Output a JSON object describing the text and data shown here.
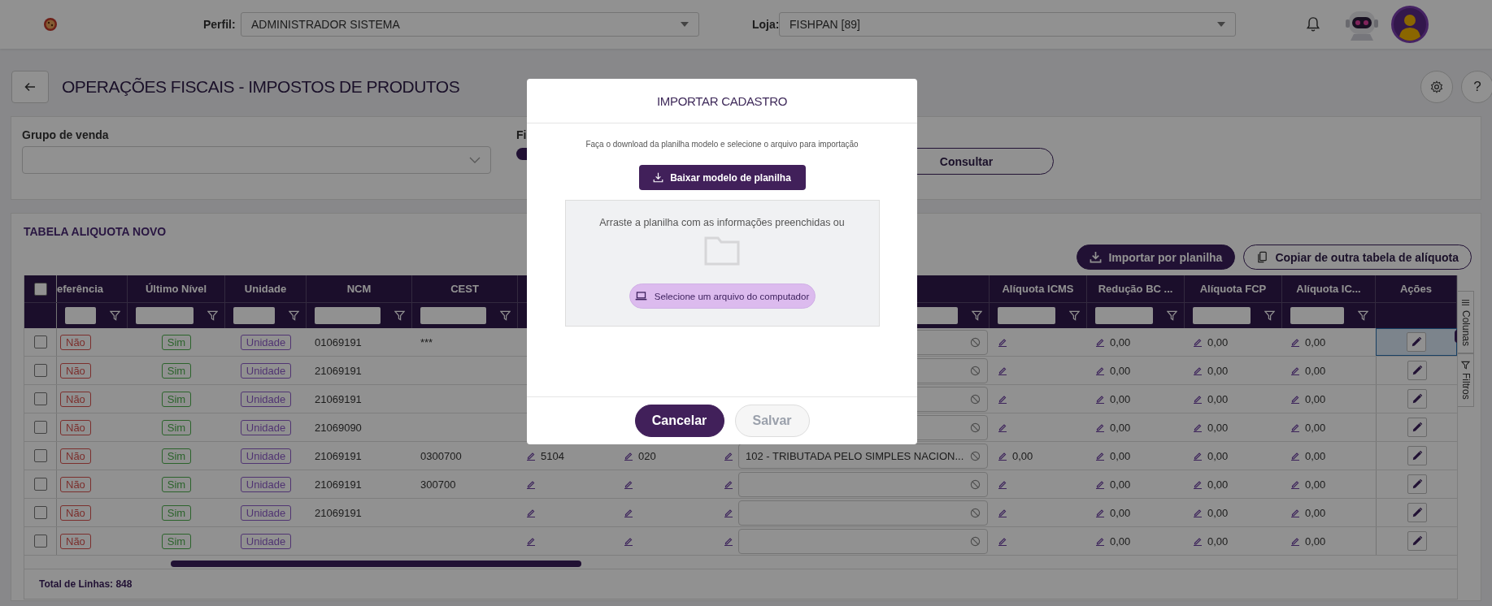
{
  "header": {
    "perfil": {
      "label": "Perfil:",
      "value": "ADMINISTRADOR SISTEMA"
    },
    "loja": {
      "label": "Loja:",
      "value": "FISHPAN [89]"
    }
  },
  "page_title": "OPERAÇÕES FISCAIS - IMPOSTOS DE PRODUTOS",
  "help_button": "?",
  "filters": {
    "grupo_de_venda": {
      "label": "Grupo de venda"
    },
    "column_2": {
      "label": "Fi",
      "on": true
    },
    "button": "Consultar"
  },
  "table": {
    "title": "TABELA ALIQUOTA NOVO",
    "buttons": [
      {
        "label": "Importar por planilha",
        "kind": "primary"
      },
      {
        "label": "Copiar de outra tabela de alíquota",
        "kind": "outline"
      }
    ],
    "select_all": false,
    "columns": [
      {
        "kind": "danger",
        "label": "eferência",
        "filter": true
      },
      {
        "kind": "success",
        "label": "Último Nível",
        "filter": true
      },
      {
        "kind": "info",
        "label": "Unidade",
        "filter": true
      },
      {
        "kind": "text",
        "label": "NCM",
        "filter": true
      },
      {
        "kind": "text",
        "label": "CEST",
        "filter": true
      },
      {
        "kind": "edit"
      },
      {
        "kind": "edit"
      },
      {
        "kind": "field",
        "filter": true
      },
      {
        "kind": "edit",
        "label": "Alíquota ICMS",
        "filter": true
      },
      {
        "kind": "edit",
        "label": "Redução BC ...",
        "filter": true
      },
      {
        "kind": "edit",
        "label": "Alíquota FCP",
        "filter": true
      },
      {
        "kind": "edit",
        "label": "Alíquota IC...",
        "filter": true
      },
      {
        "kind": "action",
        "label": "Ações",
        "filter": false
      }
    ],
    "rows": [
      {
        "checked": false,
        "selected": true,
        "cells": [
          "Não",
          "Sim",
          "Unidade",
          "01069191",
          "***",
          null,
          null,
          true,
          true,
          "0,00",
          "0,00",
          "0,00",
          true
        ]
      },
      {
        "checked": false,
        "selected": false,
        "cells": [
          "Não",
          "Sim",
          "Unidade",
          "21069191",
          null,
          null,
          null,
          true,
          true,
          "0,00",
          "0,00",
          "0,00",
          true
        ]
      },
      {
        "checked": false,
        "selected": false,
        "cells": [
          "Não",
          "Sim",
          "Unidade",
          "21069191",
          null,
          null,
          null,
          true,
          true,
          "0,00",
          "0,00",
          "0,00",
          true
        ]
      },
      {
        "checked": false,
        "selected": false,
        "cells": [
          "Não",
          "Sim",
          "Unidade",
          "21069090",
          null,
          null,
          null,
          true,
          true,
          "0,00",
          "0,00",
          "0,00",
          true
        ]
      },
      {
        "checked": false,
        "selected": false,
        "cells": [
          "Não",
          "Sim",
          "Unidade",
          "21069191",
          "0300700",
          "5104",
          "020",
          {
            "pencil": true,
            "text": "102 - TRIBUTADA PELO SIMPLES NACION..."
          },
          "0,00",
          "0,00",
          "0,00",
          "0,00",
          true
        ]
      },
      {
        "checked": false,
        "selected": false,
        "cells": [
          "Não",
          "Sim",
          "Unidade",
          "21069191",
          "300700",
          true,
          true,
          {
            "pencil": true
          },
          true,
          "0,00",
          "0,00",
          "0,00",
          true
        ]
      },
      {
        "checked": false,
        "selected": false,
        "cells": [
          "Não",
          "Sim",
          "Unidade",
          "21069191",
          null,
          true,
          true,
          {
            "pencil": true
          },
          true,
          "0,00",
          "0,00",
          "0,00",
          true
        ]
      },
      {
        "checked": false,
        "selected": false,
        "cells": [
          "Não",
          "Sim",
          "Unidade",
          null,
          null,
          true,
          true,
          {
            "pencil": true
          },
          true,
          "0,00",
          "0,00",
          "0,00",
          true
        ]
      }
    ],
    "side_tabs": [
      {
        "label": "Colunas",
        "kind": "columns"
      },
      {
        "label": "Filtros",
        "kind": "filters"
      }
    ],
    "total": "Total de Linhas: 848"
  },
  "dialog": {
    "title": "IMPORTAR CADASTRO",
    "instruction": "Faça o download da planilha modelo e selecione o arquivo para importação",
    "download_button": "Baixar modelo de planilha",
    "dropzone": {
      "text": "Arraste a planilha com as informações preenchidas ou",
      "button": "Selecione um arquivo do computador"
    },
    "buttons": [
      {
        "label": "Cancelar",
        "disabled": false
      },
      {
        "label": "Salvar",
        "disabled": true
      }
    ]
  }
}
